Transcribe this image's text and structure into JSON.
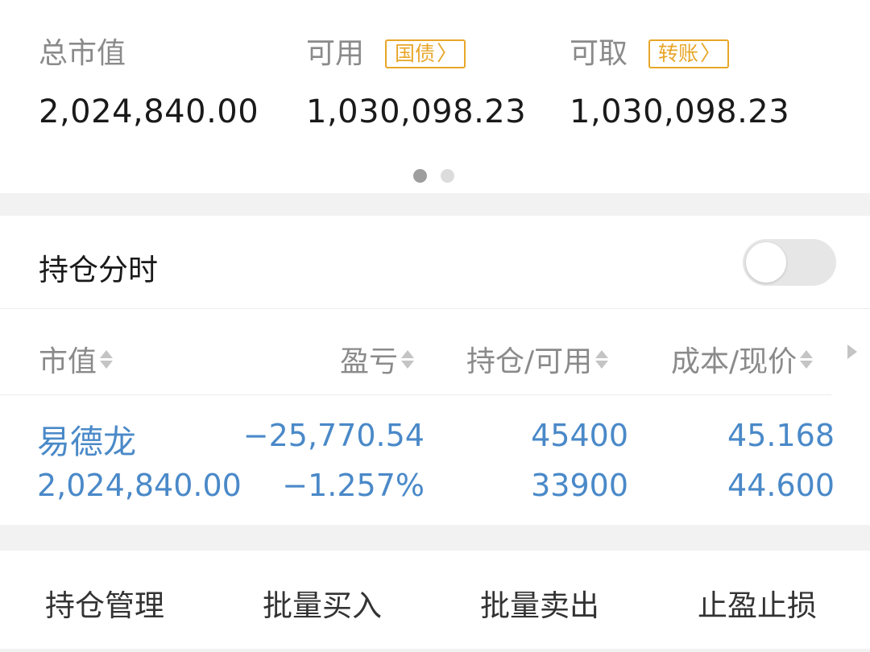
{
  "summary": {
    "total_market_value": {
      "label": "总市值",
      "value": "2,024,840.00"
    },
    "available": {
      "label": "可用",
      "tag": "国债",
      "value": "1,030,098.23"
    },
    "withdrawable": {
      "label": "可取",
      "tag": "转账",
      "value": "1,030,098.23"
    },
    "tag_chevron": "〉",
    "page_dots": {
      "count": 2,
      "active": 0
    }
  },
  "holdings": {
    "title": "持仓分时",
    "toggle_on": false,
    "columns": [
      {
        "label": "市值"
      },
      {
        "label": "盈亏"
      },
      {
        "label": "持仓/可用"
      },
      {
        "label": "成本/现价"
      }
    ],
    "rows": [
      {
        "name": "易德龙",
        "market_value": "2,024,840.00",
        "profit_loss": "−25,770.54",
        "profit_loss_pct": "−1.257%",
        "position": "45400",
        "available": "33900",
        "cost": "45.168",
        "price": "44.600"
      }
    ]
  },
  "actions": [
    {
      "label": "持仓管理"
    },
    {
      "label": "批量买入"
    },
    {
      "label": "批量卖出"
    },
    {
      "label": "止盈止损"
    }
  ],
  "colors": {
    "accent_blue": "#4a89c8",
    "tag_orange": "#e8a628",
    "label_gray": "#8a8a8a"
  },
  "icons": [
    "chevron-right-icon",
    "sort-icon",
    "more-columns-arrow-icon"
  ]
}
